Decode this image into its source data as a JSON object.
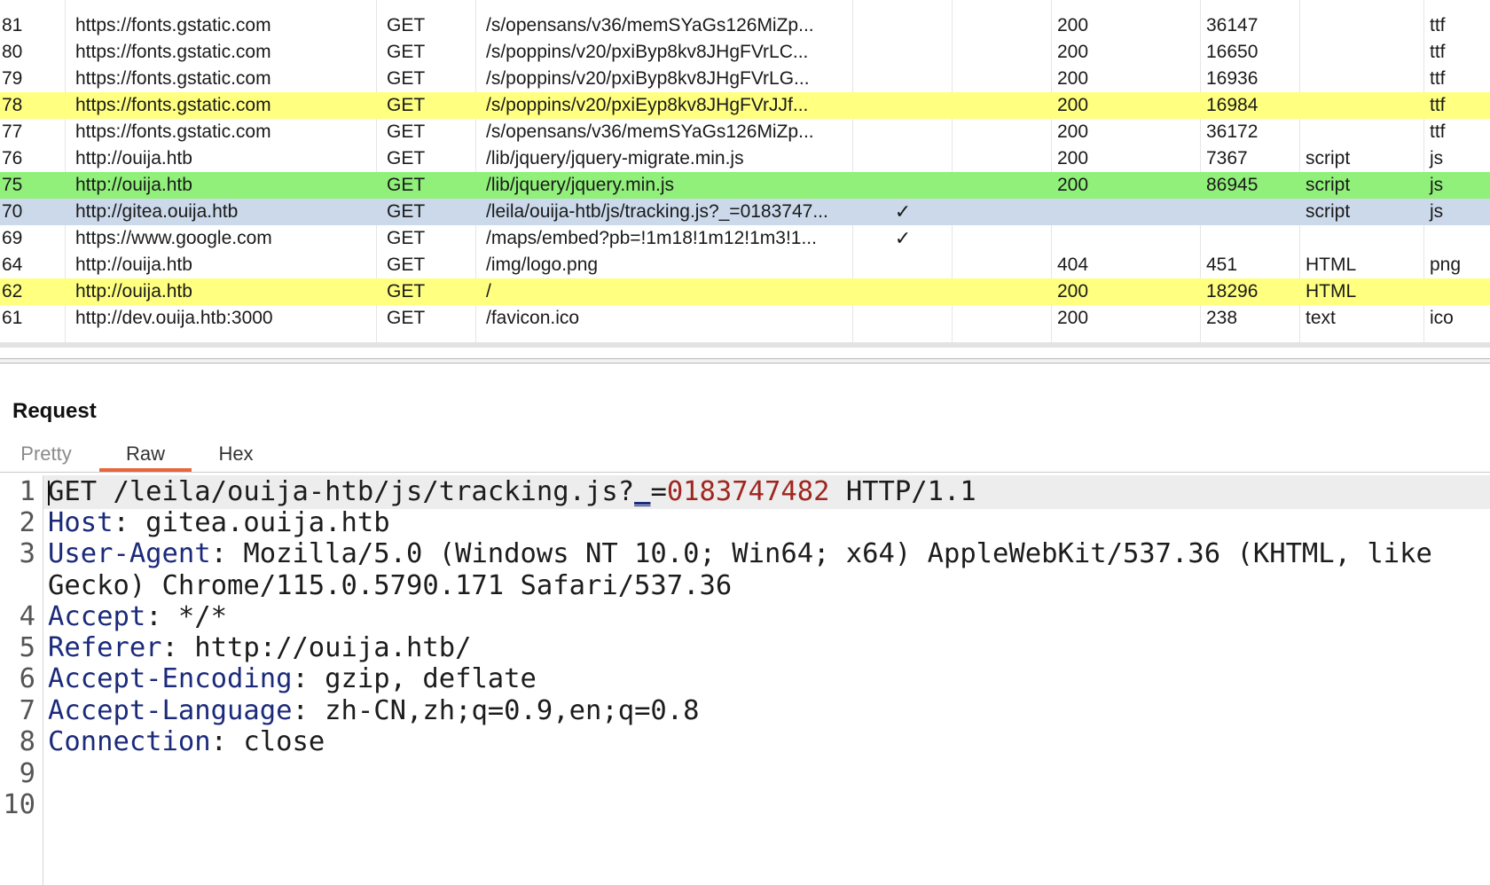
{
  "history": {
    "rows": [
      {
        "num": "",
        "host": "",
        "method": "",
        "url": "",
        "params": "",
        "edited": "",
        "status": "",
        "length": "",
        "mime": "",
        "ext": "",
        "highlight": "none"
      },
      {
        "num": "81",
        "host": "https://fonts.gstatic.com",
        "method": "GET",
        "url": "/s/opensans/v36/memSYaGs126MiZp...",
        "params": "",
        "edited": "",
        "status": "200",
        "length": "36147",
        "mime": "",
        "ext": "ttf",
        "highlight": "none"
      },
      {
        "num": "80",
        "host": "https://fonts.gstatic.com",
        "method": "GET",
        "url": "/s/poppins/v20/pxiByp8kv8JHgFVrLC...",
        "params": "",
        "edited": "",
        "status": "200",
        "length": "16650",
        "mime": "",
        "ext": "ttf",
        "highlight": "none"
      },
      {
        "num": "79",
        "host": "https://fonts.gstatic.com",
        "method": "GET",
        "url": "/s/poppins/v20/pxiByp8kv8JHgFVrLG...",
        "params": "",
        "edited": "",
        "status": "200",
        "length": "16936",
        "mime": "",
        "ext": "ttf",
        "highlight": "none"
      },
      {
        "num": "78",
        "host": "https://fonts.gstatic.com",
        "method": "GET",
        "url": "/s/poppins/v20/pxiEyp8kv8JHgFVrJJf...",
        "params": "",
        "edited": "",
        "status": "200",
        "length": "16984",
        "mime": "",
        "ext": "ttf",
        "highlight": "yellow"
      },
      {
        "num": "77",
        "host": "https://fonts.gstatic.com",
        "method": "GET",
        "url": "/s/opensans/v36/memSYaGs126MiZp...",
        "params": "",
        "edited": "",
        "status": "200",
        "length": "36172",
        "mime": "",
        "ext": "ttf",
        "highlight": "none"
      },
      {
        "num": "76",
        "host": "http://ouija.htb",
        "method": "GET",
        "url": "/lib/jquery/jquery-migrate.min.js",
        "params": "",
        "edited": "",
        "status": "200",
        "length": "7367",
        "mime": "script",
        "ext": "js",
        "highlight": "none"
      },
      {
        "num": "75",
        "host": "http://ouija.htb",
        "method": "GET",
        "url": "/lib/jquery/jquery.min.js",
        "params": "",
        "edited": "",
        "status": "200",
        "length": "86945",
        "mime": "script",
        "ext": "js",
        "highlight": "green"
      },
      {
        "num": "70",
        "host": "http://gitea.ouija.htb",
        "method": "GET",
        "url": "/leila/ouija-htb/js/tracking.js?_=0183747...",
        "params": "✓",
        "edited": "",
        "status": "",
        "length": "",
        "mime": "script",
        "ext": "js",
        "highlight": "selected"
      },
      {
        "num": "69",
        "host": "https://www.google.com",
        "method": "GET",
        "url": "/maps/embed?pb=!1m18!1m12!1m3!1...",
        "params": "✓",
        "edited": "",
        "status": "",
        "length": "",
        "mime": "",
        "ext": "",
        "highlight": "none"
      },
      {
        "num": "64",
        "host": "http://ouija.htb",
        "method": "GET",
        "url": "/img/logo.png",
        "params": "",
        "edited": "",
        "status": "404",
        "length": "451",
        "mime": "HTML",
        "ext": "png",
        "highlight": "none"
      },
      {
        "num": "62",
        "host": "http://ouija.htb",
        "method": "GET",
        "url": "/",
        "params": "",
        "edited": "",
        "status": "200",
        "length": "18296",
        "mime": "HTML",
        "ext": "",
        "highlight": "yellow"
      },
      {
        "num": "61",
        "host": "http://dev.ouija.htb:3000",
        "method": "GET",
        "url": "/favicon.ico",
        "params": "",
        "edited": "",
        "status": "200",
        "length": "238",
        "mime": "text",
        "ext": "ico",
        "highlight": "none"
      }
    ]
  },
  "request": {
    "title": "Request",
    "tabs": [
      {
        "label": "Pretty",
        "active": false
      },
      {
        "label": "Raw",
        "active": true
      },
      {
        "label": "Hex",
        "active": false
      }
    ],
    "lines": {
      "l1": {
        "num": "1",
        "method": "GET /leila/ouija-htb/js/tracking.js?",
        "param_name": "_",
        "equals": "=",
        "param_value": "0183747482",
        "version": " HTTP/1.1"
      },
      "l2": {
        "num": "2",
        "name": "Host",
        "value": ": gitea.ouija.htb"
      },
      "l3": {
        "num": "3",
        "name": "User-Agent",
        "value": ": Mozilla/5.0 (Windows NT 10.0; Win64; x64) AppleWebKit/537.36 (KHTML, like"
      },
      "l3b": {
        "num": "",
        "value": "Gecko) Chrome/115.0.5790.171 Safari/537.36"
      },
      "l4": {
        "num": "4",
        "name": "Accept",
        "value": ": */*"
      },
      "l5": {
        "num": "5",
        "name": "Referer",
        "value": ": http://ouija.htb/"
      },
      "l6": {
        "num": "6",
        "name": "Accept-Encoding",
        "value": ": gzip, deflate"
      },
      "l7": {
        "num": "7",
        "name": "Accept-Language",
        "value": ": zh-CN,zh;q=0.9,en;q=0.8"
      },
      "l8": {
        "num": "8",
        "name": "Connection",
        "value": ": close"
      },
      "l9": {
        "num": "9"
      },
      "l10": {
        "num": "10"
      }
    }
  },
  "colors": {
    "row_yellow": "#ffff80",
    "row_green": "#90f07a",
    "row_selected": "#cbd9ea",
    "tab_accent": "#e8663e",
    "header_name": "#1b2a7a",
    "param_value": "#a0261f"
  }
}
